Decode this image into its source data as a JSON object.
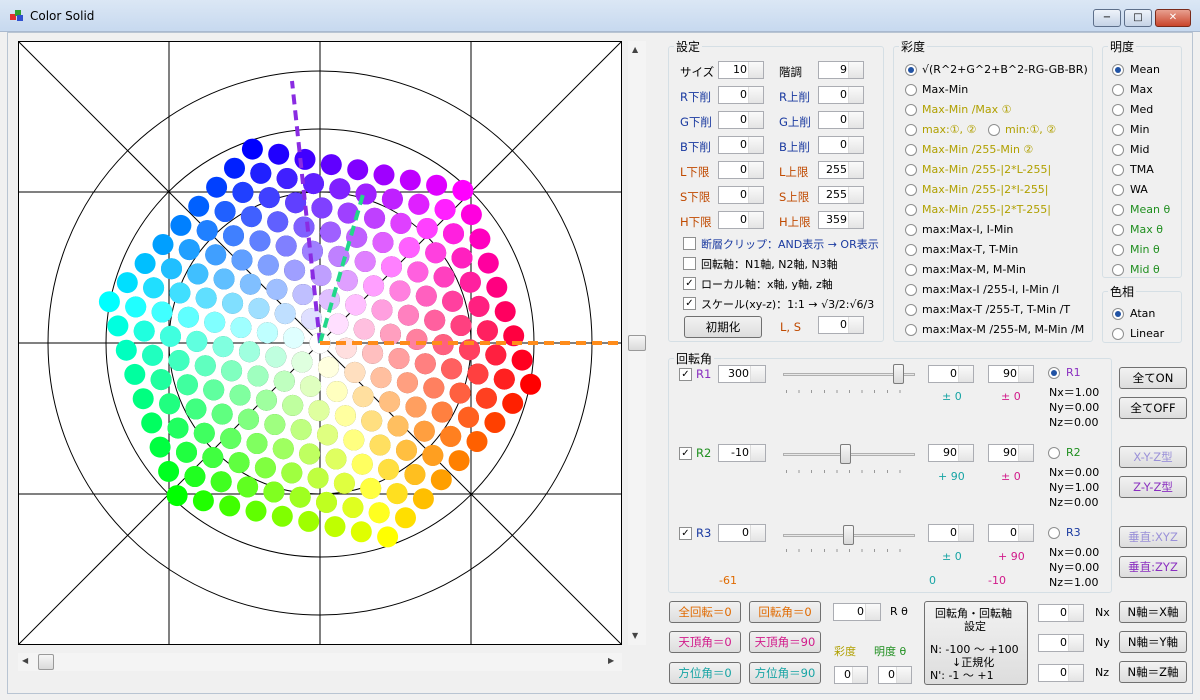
{
  "window": {
    "title": "Color Solid",
    "min": "−",
    "max": "□",
    "close": "✕"
  },
  "settings": {
    "title": "設定",
    "size": {
      "label": "サイズ",
      "value": "10"
    },
    "steps": {
      "label": "階調",
      "value": "9"
    },
    "r_low": {
      "label": "R下削",
      "value": "0"
    },
    "r_high": {
      "label": "R上削",
      "value": "0"
    },
    "g_low": {
      "label": "G下削",
      "value": "0"
    },
    "g_high": {
      "label": "G上削",
      "value": "0"
    },
    "b_low": {
      "label": "B下削",
      "value": "0"
    },
    "b_high": {
      "label": "B上削",
      "value": "0"
    },
    "l_min": {
      "label": "L下限",
      "value": "0"
    },
    "l_max": {
      "label": "L上限",
      "value": "255"
    },
    "s_min": {
      "label": "S下限",
      "value": "0"
    },
    "s_max": {
      "label": "S上限",
      "value": "255"
    },
    "h_min": {
      "label": "H下限",
      "value": "0"
    },
    "h_max": {
      "label": "H上限",
      "value": "359"
    },
    "chk_clip": "断層クリップ：AND表示 → OR表示",
    "chk_axis": "回転軸：N1軸, N2軸, N3軸",
    "chk_local": "ローカル軸：x軸, y軸, z軸",
    "chk_scale": "スケール(xy-z)：1:1 → √3/2:√6/3",
    "reset": "初期化",
    "ls_label": "L, S",
    "ls_value": "0"
  },
  "saturation": {
    "title": "彩度",
    "options": [
      "√(R^2+G^2+B^2-RG-GB-BR)",
      "Max-Min",
      "Max-Min /Max  ①",
      "max:①, ②",
      "min:①, ②",
      "Max-Min /255-Min  ②",
      "Max-Min /255-|2*L-255|",
      "Max-Min /255-|2*I-255|",
      "Max-Min /255-|2*T-255|",
      "max:Max-I, I-Min",
      "max:Max-T, T-Min",
      "max:Max-M, M-Min",
      "max:Max-I /255-I, I-Min /I",
      "max:Max-T /255-T, T-Min /T",
      "max:Max-M /255-M, M-Min /M"
    ]
  },
  "lightness": {
    "title": "明度",
    "options": [
      "Mean",
      "Max",
      "Med",
      "Min",
      "Mid",
      "TMA",
      "WA",
      "Mean θ",
      "Max θ",
      "Min θ",
      "Mid θ"
    ]
  },
  "hue": {
    "title": "色相",
    "options": [
      "Atan",
      "Linear"
    ]
  },
  "rotation": {
    "title": "回転角",
    "r1": {
      "label": "R1",
      "value": "300",
      "a": "0",
      "b": "90",
      "pa": "± 0",
      "pb": "± 0",
      "radio": "R1",
      "nx": "Nx＝1.00",
      "ny": "Ny＝0.00",
      "nz": "Nz＝0.00"
    },
    "r2": {
      "label": "R2",
      "value": "-10",
      "a": "90",
      "b": "90",
      "pa": "+ 90",
      "pb": "± 0",
      "radio": "R2",
      "nx": "Nx＝0.00",
      "ny": "Ny＝1.00",
      "nz": "Nz＝0.00"
    },
    "r3": {
      "label": "R3",
      "value": "0",
      "a": "0",
      "b": "0",
      "pa": "± 0",
      "pb": "+ 90",
      "radio": "R3",
      "nx": "Nx＝0.00",
      "ny": "Ny＝0.00",
      "nz": "Nz＝1.00"
    },
    "foot1": "-61",
    "foot2": "0",
    "foot3": "-10",
    "all_on": "全てON",
    "all_off": "全てOFF",
    "xyz": "X-Y-Z型",
    "zyz": "Z-Y-Z型",
    "perp_xyz": "垂直:XYZ",
    "perp_zyz": "垂直:ZYZ"
  },
  "bottom": {
    "all_rot": "全回転＝0",
    "rot_angle": "回転角＝0",
    "zenith0": "天頂角＝0",
    "zenith90": "天頂角＝90",
    "azim0": "方位角＝0",
    "azim90": "方位角＝90",
    "rtheta_value": "0",
    "rtheta_label": "R θ",
    "sat_label": "彩度",
    "light_label": "明度 θ",
    "sat_value": "0",
    "light_value": "0",
    "panel_title1": "回転角・回転軸",
    "panel_title2": "設定",
    "panel_l1": "N: -100 ～ +100",
    "panel_l2": "↓正規化",
    "panel_l3": "N': -1 ～ +1",
    "nx_value": "0",
    "ny_value": "0",
    "nz_value": "0",
    "nx": "Nx",
    "ny": "Ny",
    "nz": "Nz",
    "nx_btn": "N軸＝X軸",
    "ny_btn": "N軸＝Y軸",
    "nz_btn": "N軸＝Z軸"
  },
  "colors": {
    "blue_label": "#1a3aa0",
    "orange_label": "#c04a00",
    "olive": "#b0a000",
    "green": "#1f8f1f",
    "purple": "#8a2fc0",
    "pink": "#d11a8a",
    "cyan": "#17a4a4",
    "orange_btn": "#e06a00"
  }
}
